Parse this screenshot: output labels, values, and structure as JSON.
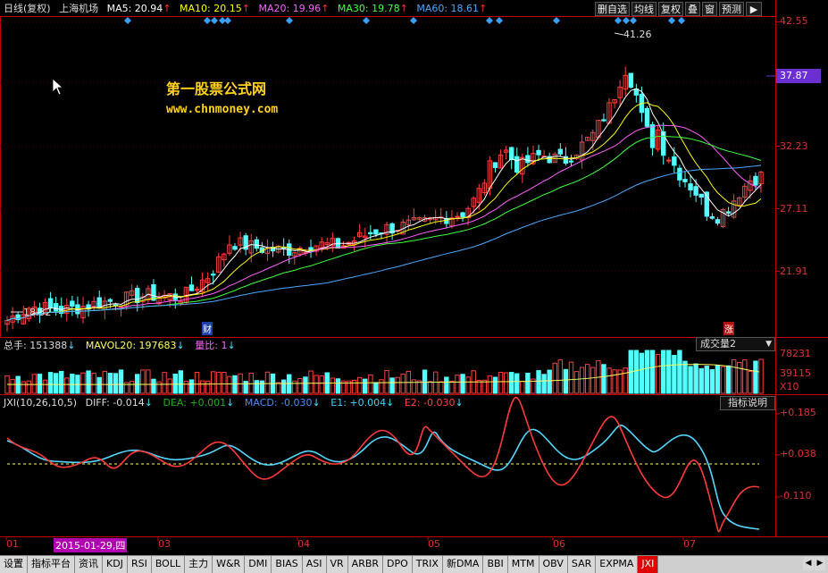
{
  "header": {
    "period": "日线(复权)",
    "stock_name": "上海机场",
    "ma5": "MA5: 20.94",
    "ma10": "MA10: 20.15",
    "ma20": "MA20: 19.96",
    "ma30": "MA30: 19.78",
    "ma60": "MA60: 18.61",
    "arrow": "↑",
    "toolbar": [
      "删自选",
      "均线",
      "复权",
      "叠",
      "窗",
      "预测"
    ],
    "toolbar_more": "▶"
  },
  "price_axis": [
    "42.55",
    "37.87",
    "32.23",
    "27.11",
    "21.91"
  ],
  "current_price": "37.87",
  "annotations": {
    "high": "41.26",
    "low": "18.52",
    "cai_marker": "财",
    "zhang_marker": "涨"
  },
  "watermark": {
    "name": "第一股票公式网",
    "url": "www.chnmoney.com"
  },
  "volume_header": {
    "total": "总手: 151388",
    "mavol20": "MAVOL20: 197683",
    "ratio": "量比: 1",
    "down_arrow": "↓",
    "selector": "成交量2",
    "axis": [
      "78231",
      "39115",
      "X10"
    ]
  },
  "indicator_header": {
    "name": "JXI(10,26,10,5)",
    "diff": "DIFF: -0.014",
    "dea": "DEA: +0.001",
    "macd": "MACD: -0.030",
    "e1": "E1: +0.004",
    "e2": "E2: -0.030",
    "down_arrow": "↓",
    "help": "指标说明",
    "axis": [
      "+0.185",
      "+0.038",
      "-0.110"
    ]
  },
  "date_axis": {
    "labels": [
      "01",
      "03",
      "04",
      "05",
      "06",
      "07"
    ],
    "cursor_date": "2015-01-29,四"
  },
  "tabs": [
    "设置",
    "指标平台",
    "资讯",
    "KDJ",
    "RSI",
    "BOLL",
    "主力",
    "W&R",
    "DMI",
    "BIAS",
    "ASI",
    "VR",
    "ARBR",
    "DPO",
    "TRIX",
    "新DMA",
    "BBI",
    "MTM",
    "OBV",
    "SAR",
    "EXPMA",
    "JXI"
  ],
  "active_tab": "JXI",
  "colors": {
    "up": "#ff4040",
    "down": "#54ffff",
    "ma5": "#ffffff",
    "ma10": "#ffff00",
    "ma20": "#ff60ff",
    "ma30": "#40ff40",
    "ma60": "#4aa8ff",
    "axis": "#c00000"
  },
  "chart_data": {
    "type": "candlestick",
    "price_range": [
      18.0,
      43.5
    ],
    "high": 41.26,
    "low": 18.52
  }
}
